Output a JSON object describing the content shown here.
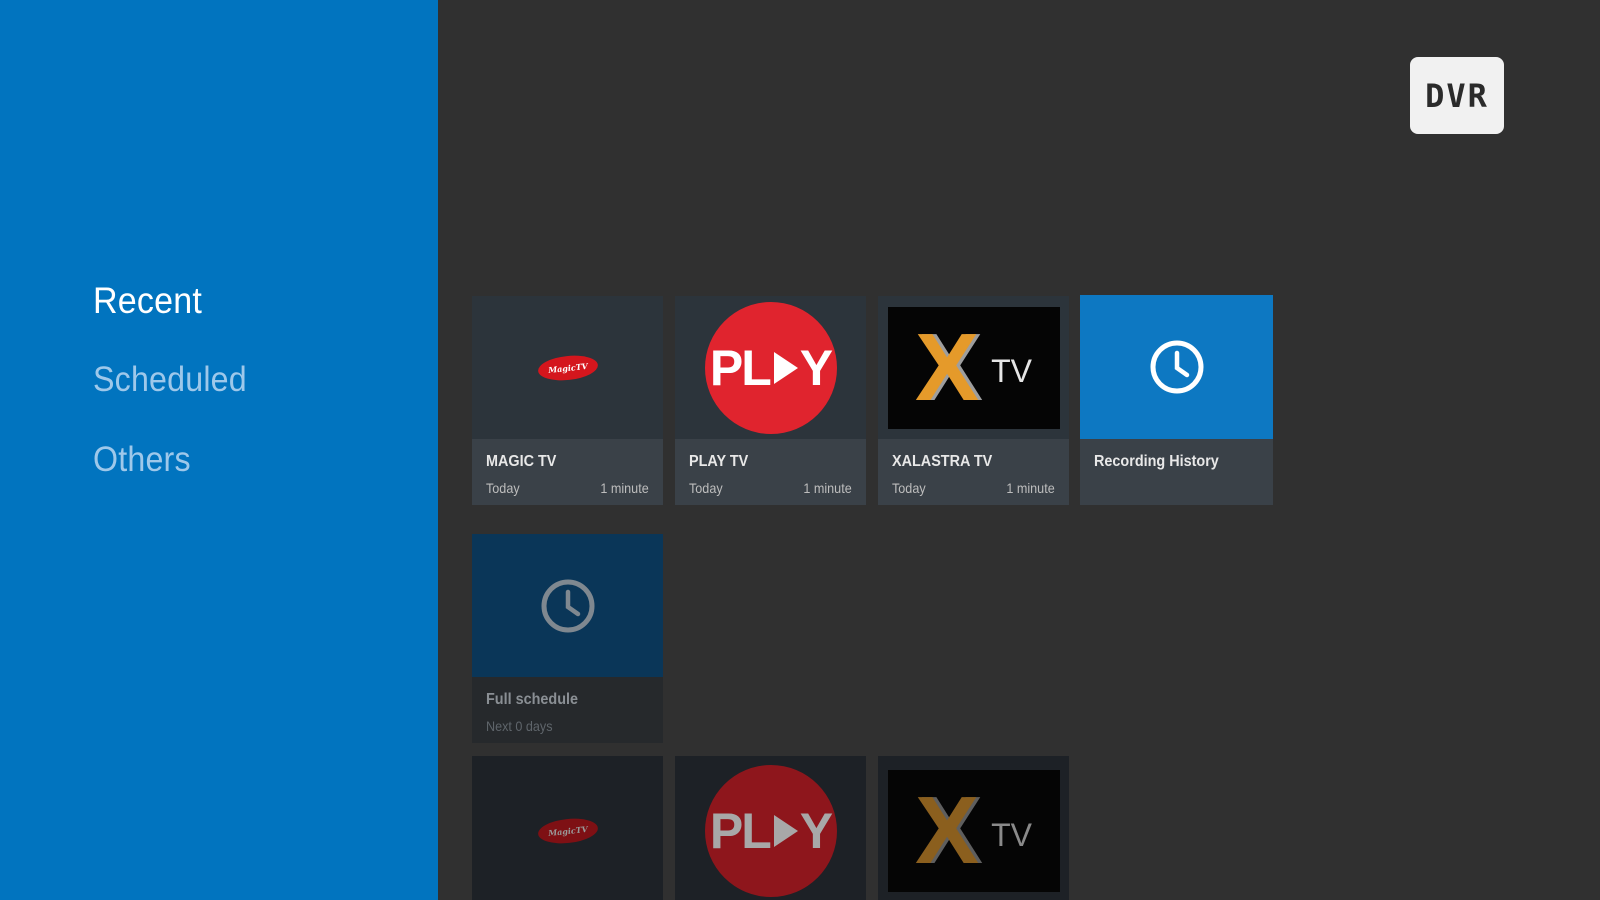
{
  "sidebar": {
    "items": [
      {
        "label": "Recent",
        "active": true
      },
      {
        "label": "Scheduled",
        "active": false
      },
      {
        "label": "Others",
        "active": false
      }
    ]
  },
  "header": {
    "badge_label": "DVR"
  },
  "recent_cards": [
    {
      "title": "MAGIC TV",
      "date": "Today",
      "duration": "1 minute",
      "logo": "magic-tv-logo",
      "logo_text": "MagicTV"
    },
    {
      "title": "PLAY TV",
      "date": "Today",
      "duration": "1 minute",
      "logo": "play-tv-logo",
      "logo_text_left": "PL",
      "logo_text_right": "Y"
    },
    {
      "title": "XALASTRA TV",
      "date": "Today",
      "duration": "1 minute",
      "logo": "xalastra-tv-logo",
      "logo_x": "X",
      "logo_tv": "TV"
    },
    {
      "title": "Recording History",
      "icon": "clock-icon"
    }
  ],
  "scheduled_cards": [
    {
      "title": "Full schedule",
      "subtitle": "Next 0 days",
      "icon": "clock-icon"
    }
  ],
  "others_cards": [
    {
      "logo": "magic-tv-logo",
      "logo_text": "MagicTV"
    },
    {
      "logo": "play-tv-logo",
      "logo_text_left": "PL",
      "logo_text_right": "Y"
    },
    {
      "logo": "xalastra-tv-logo",
      "logo_x": "X",
      "logo_tv": "TV"
    }
  ],
  "colors": {
    "sidebar_bg": "#0174bf",
    "main_bg": "#303030",
    "accent": "#0d78c2",
    "play_red": "#e0242e",
    "xtv_orange": "#e59a2a"
  }
}
